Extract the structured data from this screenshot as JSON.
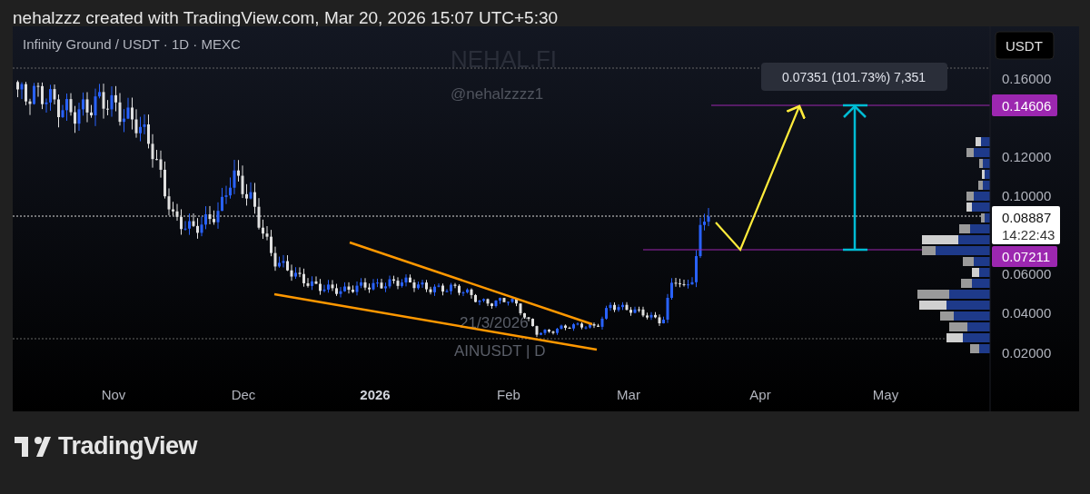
{
  "caption": "nehalzzz created with TradingView.com, Mar 20, 2026 15:07 UTC+5:30",
  "chart": {
    "symbol_title": "Infinity Ground / USDT · 1D · MEXC",
    "watermarks": [
      "NEHAL.FI",
      "@nehalzzzz1",
      "21/3/2026",
      "AINUSDT | D"
    ],
    "currency_button": "USDT",
    "measure_tooltip": "0.07351 (101.73%) 7,351",
    "price_ticks": [
      "0.16000",
      "0.12000",
      "0.10000",
      "0.06000",
      "0.04000",
      "0.02000"
    ],
    "target_label": "0.14606",
    "current_label": {
      "price": "0.08887",
      "countdown": "14:22:43"
    },
    "base_label": "0.07211",
    "time_ticks": [
      {
        "label": "Nov",
        "bold": false
      },
      {
        "label": "Dec",
        "bold": false
      },
      {
        "label": "2026",
        "bold": true
      },
      {
        "label": "Feb",
        "bold": false
      },
      {
        "label": "Mar",
        "bold": false
      },
      {
        "label": "Apr",
        "bold": false
      },
      {
        "label": "May",
        "bold": false
      }
    ]
  },
  "footer": {
    "brand": "TradingView"
  }
}
